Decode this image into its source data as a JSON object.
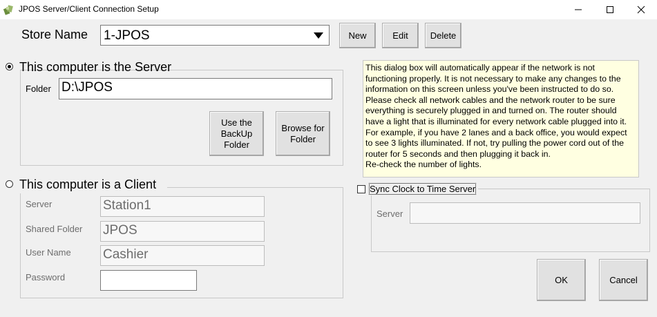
{
  "window": {
    "title": "JPOS Server/Client Connection Setup",
    "icon": "jpos-app-icon"
  },
  "store": {
    "label": "Store Name",
    "selected": "1-JPOS",
    "new_label": "New",
    "edit_label": "Edit",
    "delete_label": "Delete"
  },
  "server_group": {
    "radio_label": "This computer is the Server",
    "checked": true,
    "folder_label": "Folder",
    "folder_value": "D:\\JPOS",
    "backup_button": "Use the BackUp Folder",
    "browse_button": "Browse for Folder"
  },
  "client_group": {
    "radio_label": "This computer is a Client",
    "checked": false,
    "server_label": "Server",
    "server_value": "Station1",
    "shared_label": "Shared Folder",
    "shared_value": "JPOS",
    "user_label": "User Name",
    "user_value": "Cashier",
    "password_label": "Password",
    "password_value": ""
  },
  "info": {
    "text": "This dialog box will automatically appear if the network is not functioning properly. It is not necessary to make any changes to the information on this screen unless you've been instructed to do so. Please check all network cables and the network router to be sure everything is securely plugged in and turned on. The router should have a light that is illuminated for every network cable plugged into it. For example, if you have 2 lanes and a back office, you would expect to see 3 lights illuminated. If not, try pulling the power cord out of the router for 5 seconds and then plugging it back in.",
    "text2": "Re-check the number of lights."
  },
  "sync": {
    "label": "Sync Clock to Time Server",
    "checked": false,
    "server_label": "Server",
    "server_value": ""
  },
  "actions": {
    "ok_label": "OK",
    "cancel_label": "Cancel"
  },
  "colors": {
    "info_background": "#ffffe1",
    "dialog_background": "#f0f0f0"
  }
}
